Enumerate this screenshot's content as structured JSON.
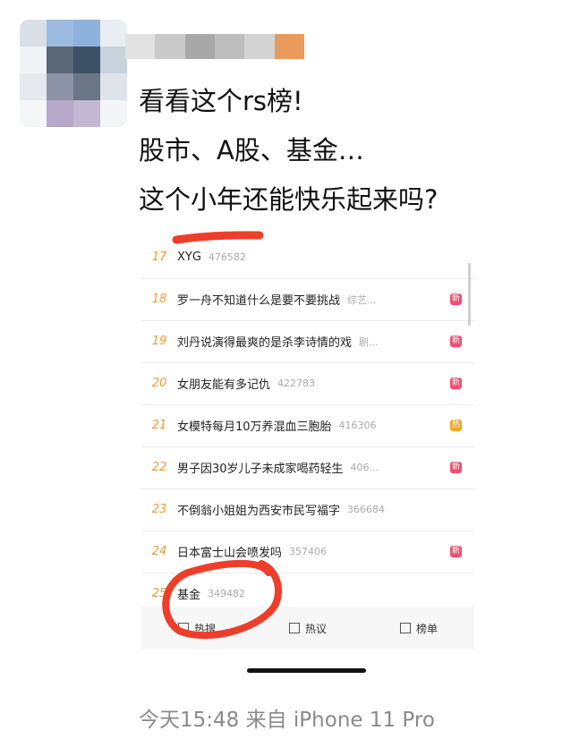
{
  "post": {
    "lines": [
      "看看这个rs榜!",
      "股市、A股、基金…",
      "这个小年还能快乐起来吗?"
    ],
    "footer": "今天15:48  来自 iPhone 11 Pro"
  },
  "hot_list": [
    {
      "rank": "17",
      "title": "XYG",
      "hot": "476582",
      "tag": ""
    },
    {
      "rank": "18",
      "title": "罗一舟不知道什么是要不要挑战",
      "hot": "综艺...",
      "tag": "新"
    },
    {
      "rank": "19",
      "title": "刘丹说演得最爽的是杀李诗情的戏",
      "hot": "剧...",
      "tag": "新"
    },
    {
      "rank": "20",
      "title": "女朋友能有多记仇",
      "hot": "422783",
      "tag": "新"
    },
    {
      "rank": "21",
      "title": "女模特每月10万养混血三胞胎",
      "hot": "416306",
      "tag": "热"
    },
    {
      "rank": "22",
      "title": "男子因30岁儿子未成家喝药轻生",
      "hot": "406...",
      "tag": "新"
    },
    {
      "rank": "23",
      "title": "不倒翁小姐姐为西安市民写福字",
      "hot": "366684",
      "tag": ""
    },
    {
      "rank": "24",
      "title": "日本富士山会喷发吗",
      "hot": "357406",
      "tag": "新"
    },
    {
      "rank": "25",
      "title": "基金",
      "hot": "349482",
      "tag": ""
    }
  ],
  "bottom_tabs": [
    {
      "label": "热搜",
      "icon": "fire-icon"
    },
    {
      "label": "热议",
      "icon": "comment-icon"
    },
    {
      "label": "榜单",
      "icon": "chart-icon"
    }
  ],
  "colors": {
    "rank": "#f29b2e",
    "tag_new": "#ef4f6e",
    "tag_hot": "#f5a623",
    "annotation": "#ee3d2a"
  }
}
